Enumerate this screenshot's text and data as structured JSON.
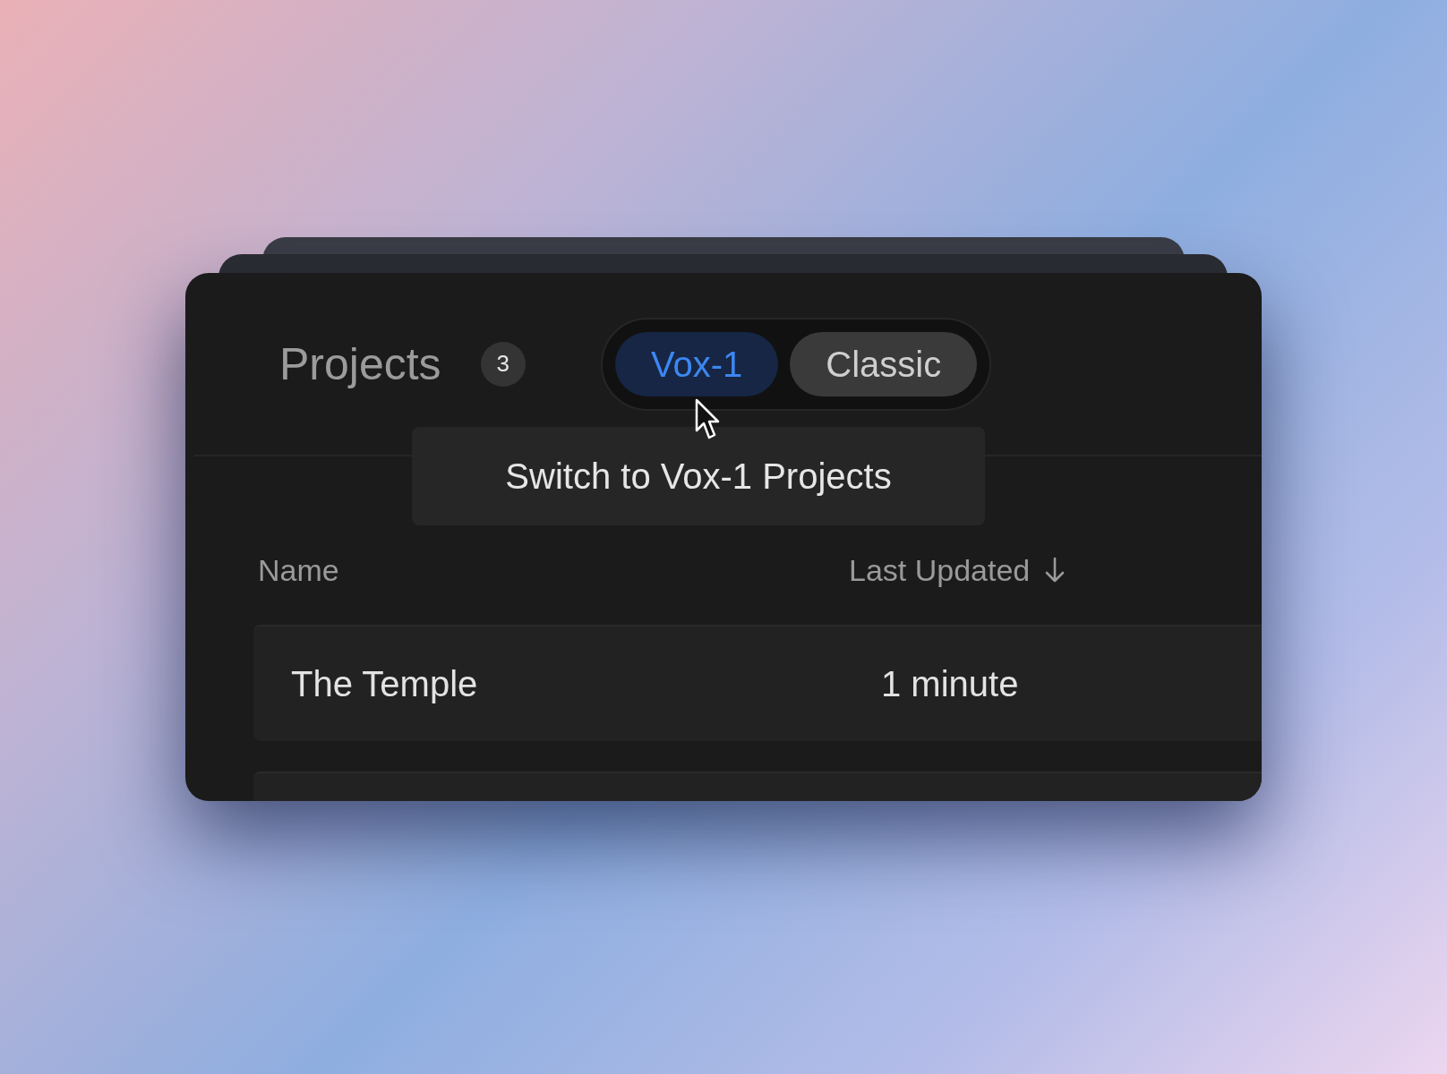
{
  "header": {
    "title": "Projects",
    "count": "3"
  },
  "toggle": [
    {
      "label": "Vox-1",
      "selected": true
    },
    {
      "label": "Classic",
      "selected": false
    }
  ],
  "tooltip": {
    "text": "Switch to Vox-1 Projects"
  },
  "table": {
    "columns": [
      {
        "label": "Name",
        "sorted": false
      },
      {
        "label": "Last Updated",
        "sorted": true
      }
    ],
    "rows": [
      {
        "name": "The Temple",
        "updated": "1 minute"
      }
    ]
  }
}
